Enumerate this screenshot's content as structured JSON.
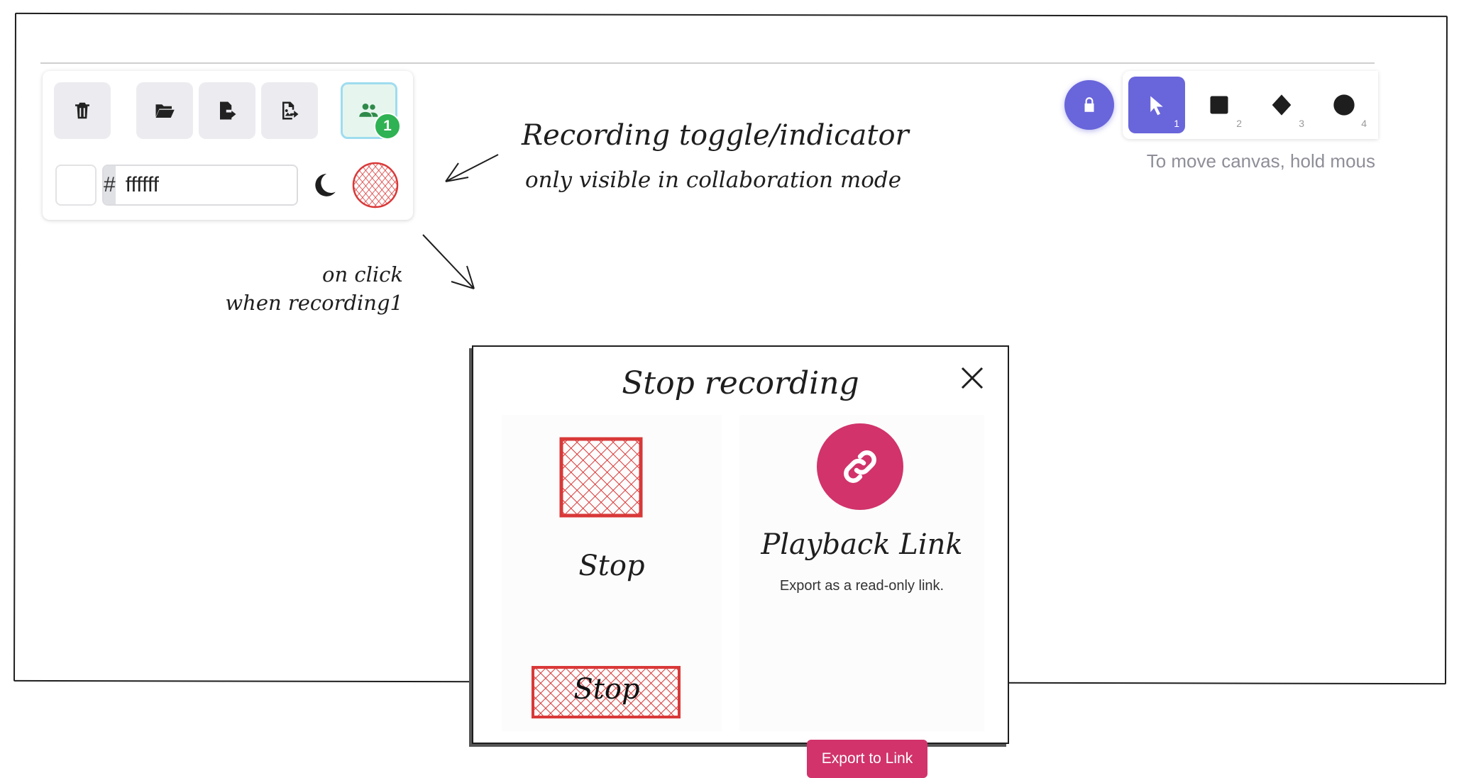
{
  "toolbar_left": {
    "delete_label": "delete",
    "open_label": "open",
    "export_label": "export",
    "export_image_label": "export image",
    "collab_badge": "1",
    "color_hash": "#",
    "color_value": "ffffff"
  },
  "toolbar_right": {
    "tools": [
      {
        "icon": "pointer-icon",
        "key": "1"
      },
      {
        "icon": "square-icon",
        "key": "2"
      },
      {
        "icon": "diamond-icon",
        "key": "3"
      },
      {
        "icon": "circle-icon",
        "key": "4"
      }
    ],
    "hint": "To move canvas, hold mous"
  },
  "annotations": {
    "title": "Recording toggle/indicator",
    "subtitle": "only visible in collaboration mode",
    "onclick_line1": "on click",
    "onclick_line2": "when recording1"
  },
  "dialog": {
    "title": "Stop recording",
    "stop_label": "Stop",
    "stop_button": "Stop",
    "playback_title": "Playback Link",
    "playback_desc": "Export as a read-only link.",
    "export_button": "Export to Link"
  },
  "colors": {
    "accent": "#6965db",
    "record_red": "#d93838",
    "link_pink": "#d1336a",
    "collab_green": "#2fb253"
  }
}
